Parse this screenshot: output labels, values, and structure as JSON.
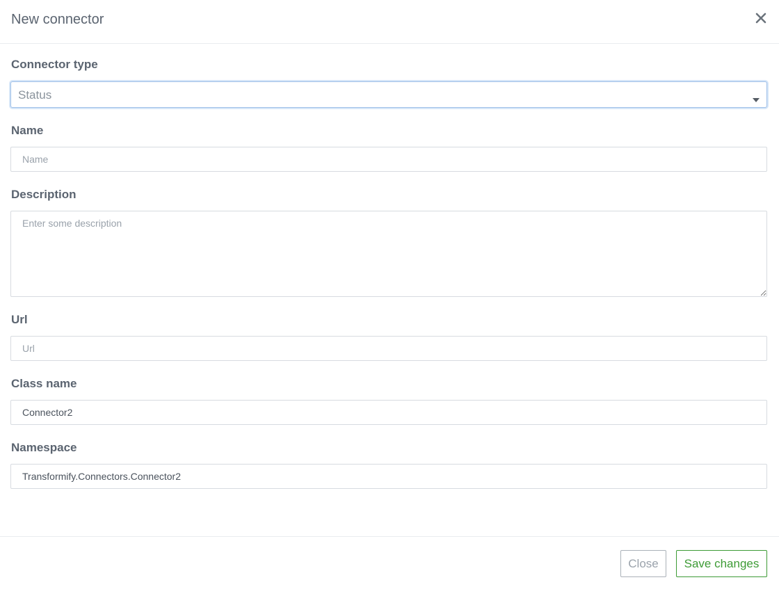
{
  "modal": {
    "title": "New connector",
    "close_icon": "close-x-icon"
  },
  "form": {
    "connector_type": {
      "label": "Connector type",
      "value": "Status"
    },
    "name": {
      "label": "Name",
      "value": "",
      "placeholder": "Name"
    },
    "description": {
      "label": "Description",
      "value": "",
      "placeholder": "Enter some description"
    },
    "url": {
      "label": "Url",
      "value": "",
      "placeholder": "Url"
    },
    "class_name": {
      "label": "Class name",
      "value": "Connector2",
      "placeholder": ""
    },
    "namespace": {
      "label": "Namespace",
      "value": "Transformify.Connectors.Connector2",
      "placeholder": ""
    }
  },
  "footer": {
    "close_label": "Close",
    "save_label": "Save changes"
  },
  "colors": {
    "text": "#5b6470",
    "border": "#d7dbe0",
    "focus": "#9fc0e8",
    "save_green": "#3d9b35"
  }
}
